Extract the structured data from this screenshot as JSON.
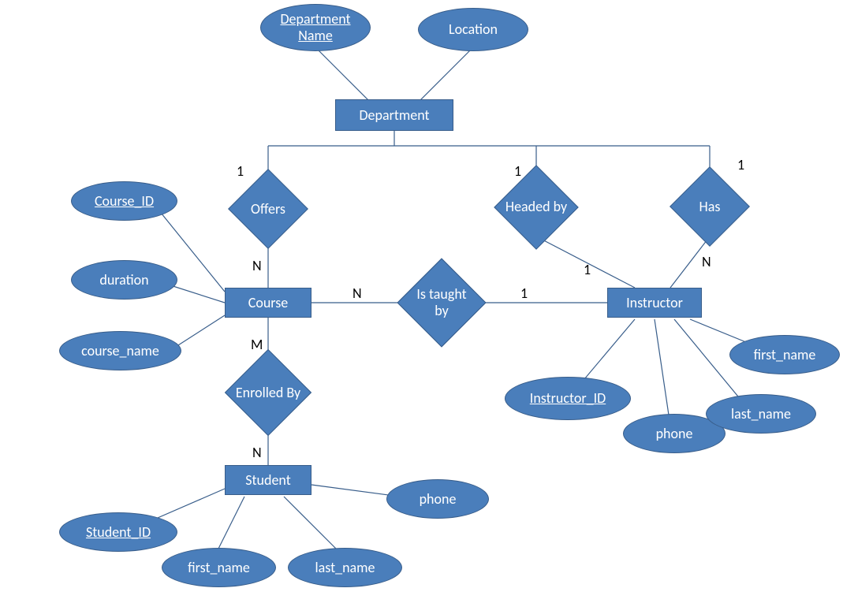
{
  "entities": {
    "department": "Department",
    "course": "Course",
    "instructor": "Instructor",
    "student": "Student"
  },
  "relationships": {
    "offers": "Offers",
    "headed_by": "Headed by",
    "has": "Has",
    "is_taught_by": "Is taught by",
    "enrolled_by": "Enrolled By"
  },
  "attributes": {
    "department_name": "Department Name",
    "location": "Location",
    "course_id": "Course_ID",
    "duration": "duration",
    "course_name": "course_name",
    "instructor_id": "Instructor_ID",
    "instr_first_name": "first_name",
    "instr_last_name": "last_name",
    "instr_phone": "phone",
    "student_id": "Student_ID",
    "stud_first_name": "first_name",
    "stud_last_name": "last_name",
    "stud_phone": "phone"
  },
  "cardinalities": {
    "offers_dep": "1",
    "offers_course": "N",
    "headed_dep": "1",
    "headed_instr": "1",
    "has_dep": "1",
    "has_instr": "N",
    "taught_course": "N",
    "taught_instr": "1",
    "enroll_course": "M",
    "enroll_student": "N"
  }
}
